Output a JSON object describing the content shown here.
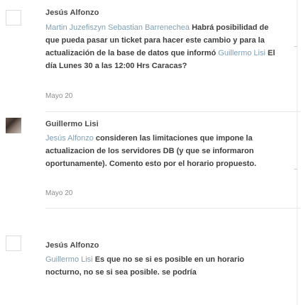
{
  "comments": [
    {
      "author": "Jesús Alfonzo",
      "parts": [
        {
          "text": "Martin Juzefiszyn",
          "mention": true
        },
        {
          "text": " ",
          "mention": true
        },
        {
          "text": "Sebastian Barrenechea",
          "mention": true
        },
        {
          "text": " Habrá posibilidad de que pueda pasar un ticket para hacer este cambio y para la actualización de la base de datos que informó ",
          "mention": false
        },
        {
          "text": "Guillermo Lisi",
          "mention": true
        },
        {
          "text": " El día Lunes 30 a las 12:00 Hrs Caracas?",
          "mention": false
        }
      ],
      "date": "Mayo 20"
    },
    {
      "author": "Guillermo Lisi",
      "parts": [
        {
          "text": "Jesús Alfonzo",
          "mention": true
        },
        {
          "text": " consideren las limitaciones que impone la actualizacion de los servidores DB (y que se informaron oportunamente). Comento esto por el horario propuesto.",
          "mention": false
        }
      ],
      "date": "Mayo 20"
    },
    {
      "author": "Jesús Alfonzo",
      "parts": [
        {
          "text": "Guillermo Lisi",
          "mention": true
        },
        {
          "text": " Es que no se si es posible en un horario nocturno, no se si sea posible. se podría",
          "mention": false
        }
      ],
      "date": ""
    }
  ]
}
